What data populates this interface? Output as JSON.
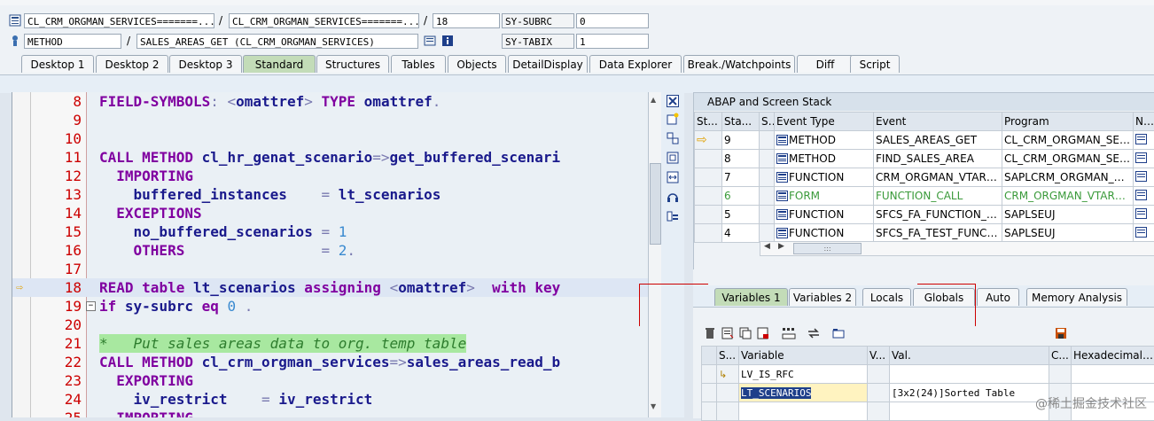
{
  "header": {
    "row1": {
      "field1": "CL_CRM_ORGMAN_SERVICES=======...",
      "field2": "CL_CRM_ORGMAN_SERVICES=======...",
      "line": "18",
      "sys_label": "SY-SUBRC",
      "sys_value": "0"
    },
    "row2": {
      "field1": "METHOD",
      "field2": "SALES_AREAS_GET (CL_CRM_ORGMAN_SERVICES)",
      "sys_label": "SY-TABIX",
      "sys_value": "1"
    },
    "separator": "/"
  },
  "tabs": [
    "Desktop 1",
    "Desktop 2",
    "Desktop 3",
    "Standard",
    "Structures",
    "Tables",
    "Objects",
    "DetailDisplay",
    "Data Explorer",
    "Break./Watchpoints",
    "Diff",
    "Script"
  ],
  "active_tab": "Standard",
  "editor": {
    "lines": [
      {
        "n": "8",
        "code": "FIELD-SYMBOLS: <omattref> TYPE omattref."
      },
      {
        "n": "9",
        "code": ""
      },
      {
        "n": "10",
        "code": ""
      },
      {
        "n": "11",
        "code": "CALL METHOD cl_hr_genat_scenario=>get_buffered_scenari"
      },
      {
        "n": "12",
        "code": "  IMPORTING"
      },
      {
        "n": "13",
        "code": "    buffered_instances    = lt_scenarios"
      },
      {
        "n": "14",
        "code": "  EXCEPTIONS"
      },
      {
        "n": "15",
        "code": "    no_buffered_scenarios = 1"
      },
      {
        "n": "16",
        "code": "    OTHERS                = 2."
      },
      {
        "n": "17",
        "code": ""
      },
      {
        "n": "18",
        "code": "READ table lt_scenarios assigning <omattref>  with key"
      },
      {
        "n": "19",
        "code": "if sy-subrc eq 0 ."
      },
      {
        "n": "20",
        "code": ""
      },
      {
        "n": "21",
        "code": "*   Put sales areas data to org. temp table"
      },
      {
        "n": "22",
        "code": "CALL METHOD cl_crm_orgman_services=>sales_areas_read_b"
      },
      {
        "n": "23",
        "code": "  EXPORTING"
      },
      {
        "n": "24",
        "code": "    iv_restrict    = iv_restrict"
      },
      {
        "n": "25",
        "code": "  IMPORTING"
      }
    ]
  },
  "stack": {
    "title": "ABAP and Screen Stack",
    "columns": [
      "St...",
      "Sta...",
      "S...",
      "Event Type",
      "Event",
      "Program",
      "Na..."
    ],
    "rows": [
      {
        "level": "9",
        "type": "METHOD",
        "event": "SALES_AREAS_GET",
        "program": "CL_CRM_ORGMAN_SERV..."
      },
      {
        "level": "8",
        "type": "METHOD",
        "event": "FIND_SALES_AREA",
        "program": "CL_CRM_ORGMAN_SERV..."
      },
      {
        "level": "7",
        "type": "FUNCTION",
        "event": "CRM_ORGMAN_VTAREA...",
        "program": "SAPLCRM_ORGMAN_REP..."
      },
      {
        "level": "6",
        "type": "FORM",
        "event": "FUNCTION_CALL",
        "program": "CRM_ORGMAN_VTAREA..."
      },
      {
        "level": "5",
        "type": "FUNCTION",
        "event": "SFCS_FA_FUNCTION_IN...",
        "program": "SAPLSEUJ"
      },
      {
        "level": "4",
        "type": "FUNCTION",
        "event": "SFCS_FA_TEST_FUNCTI...",
        "program": "SAPLSEUJ"
      }
    ],
    "scroll_grip": ":::"
  },
  "var_tabs": [
    "Variables 1",
    "Variables 2",
    "Locals",
    "Globals",
    "Auto",
    "Memory Analysis"
  ],
  "vars": {
    "columns": [
      "S...",
      "Variable",
      "V...",
      "Val.",
      "C...",
      "Hexadecimal Val"
    ],
    "rows": [
      {
        "variable": "LV_IS_RFC",
        "value": ""
      },
      {
        "variable": "LT_SCENARIOS",
        "value": "[3x2(24)]Sorted Table"
      }
    ]
  },
  "watermark": "@稀土掘金技术社区"
}
